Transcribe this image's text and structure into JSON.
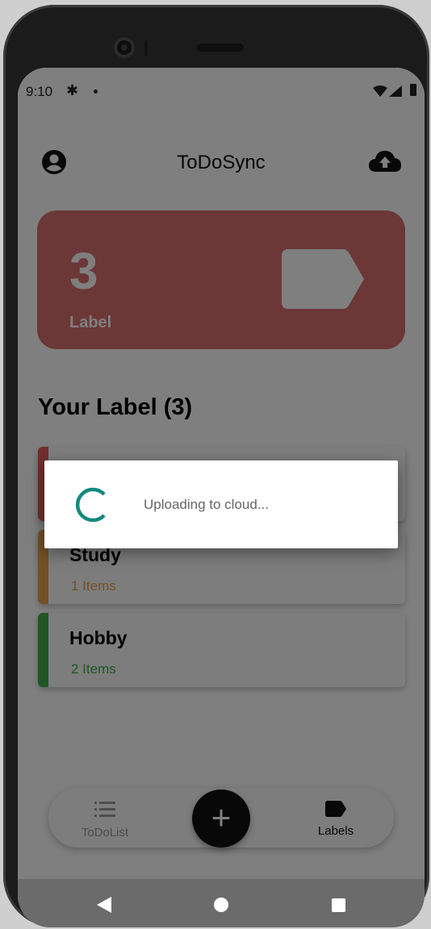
{
  "status_bar": {
    "time": "9:10"
  },
  "header": {
    "title": "ToDoSync",
    "profile_icon": "account-circle-icon",
    "upload_icon": "cloud-upload-icon"
  },
  "summary_card": {
    "count": "3",
    "caption": "Label",
    "icon": "label-tag-icon",
    "color": "#d86f6f"
  },
  "section": {
    "title": "Your Label (3)"
  },
  "labels": [
    {
      "name": "",
      "items": "",
      "color": "#e35d5d"
    },
    {
      "name": "Study",
      "items": "1 Items",
      "color": "#e9a04a"
    },
    {
      "name": "Hobby",
      "items": "2 Items",
      "color": "#3fae49"
    }
  ],
  "bottom_nav": {
    "todolist_label": "ToDoList",
    "labels_label": "Labels",
    "fab_symbol": "+"
  },
  "dialog": {
    "message": "Uploading to cloud...",
    "spinner_color": "#12897f"
  }
}
